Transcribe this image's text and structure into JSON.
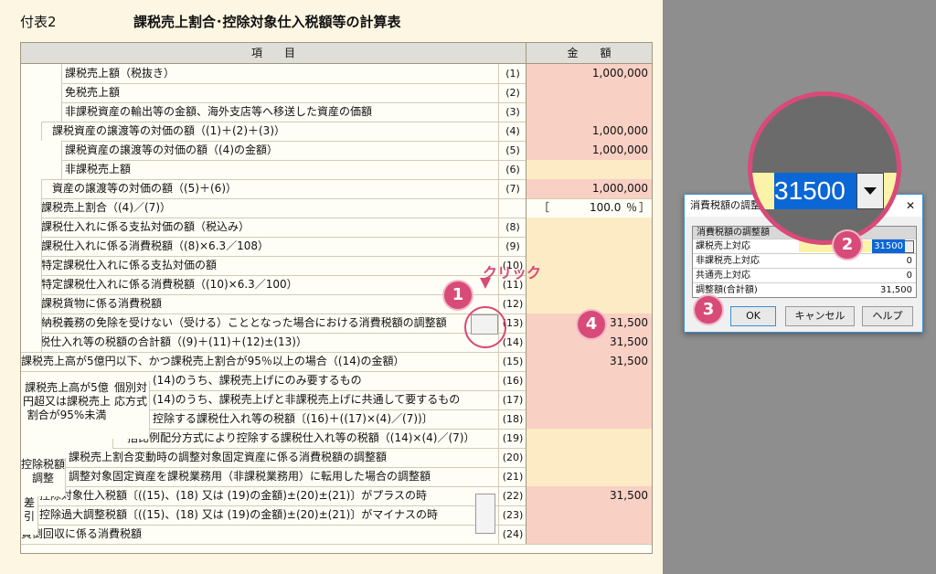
{
  "header": {
    "fuhyo": "付表2",
    "title": "課税売上割合･控除対象仕入税額等の計算表"
  },
  "table_header": {
    "item": "項　　目",
    "amount": "金　　額"
  },
  "rows": [
    {
      "label": "課税売上額（税抜き）",
      "num": "(1)",
      "amount": "1,000,000"
    },
    {
      "label": "免税売上額",
      "num": "(2)",
      "amount": ""
    },
    {
      "label": "非課税資産の輸出等の金額、海外支店等へ移送した資産の価額",
      "num": "(3)",
      "amount": ""
    },
    {
      "label": "課税資産の譲渡等の対価の額（(1)＋(2)＋(3)）",
      "num": "(4)",
      "amount": "1,000,000"
    },
    {
      "label": "課税資産の譲渡等の対価の額（(4)の金額）",
      "num": "(5)",
      "amount": "1,000,000"
    },
    {
      "label": "非課税売上額",
      "num": "(6)",
      "amount": ""
    },
    {
      "label": "資産の譲渡等の対価の額（(5)＋(6)）",
      "num": "(7)",
      "amount": "1,000,000"
    },
    {
      "label": "課税売上割合（(4)／(7)）",
      "num": "",
      "amount": ""
    },
    {
      "label": "課税仕入れに係る支払対価の額（税込み）",
      "num": "(8)",
      "amount": ""
    },
    {
      "label": "課税仕入れに係る消費税額（(8)×6.3／108）",
      "num": "(9)",
      "amount": ""
    },
    {
      "label": "特定課税仕入れに係る支払対価の額",
      "num": "(10)",
      "amount": ""
    },
    {
      "label": "特定課税仕入れに係る消費税額（(10)×6.3／100）",
      "num": "(11)",
      "amount": ""
    },
    {
      "label": "課税貨物に係る消費税額",
      "num": "(12)",
      "amount": ""
    },
    {
      "label": "納税義務の免除を受けない（受ける）こととなった場合における消費税額の調整額",
      "num": "(13)",
      "amount": "31,500"
    },
    {
      "label": "課税仕入れ等の税額の合計額（(9)＋(11)＋(12)±(13)）",
      "num": "(14)",
      "amount": "31,500"
    },
    {
      "label": "課税売上高が5億円以下、かつ課税売上割合が95％以上の場合（(14)の金額）",
      "num": "(15)",
      "amount": "31,500"
    },
    {
      "label": "(14)のうち、課税売上げにのみ要するもの",
      "num": "(16)",
      "amount": ""
    },
    {
      "label": "(14)のうち、課税売上げと非課税売上げに共通して要するもの",
      "num": "(17)",
      "amount": ""
    },
    {
      "label": "控除する課税仕入れ等の税額〔(16)＋((17)×(4)／(7))〕",
      "num": "(18)",
      "amount": ""
    },
    {
      "label": "一括比例配分方式により控除する課税仕入れ等の税額（(14)×(4)／(7)）",
      "num": "(19)",
      "amount": ""
    },
    {
      "label": "課税売上割合変動時の調整対象固定資産に係る消費税額の調整額",
      "num": "(20)",
      "amount": ""
    },
    {
      "label": "調整対象固定資産を課税業務用（非課税業務用）に転用した場合の調整額",
      "num": "(21)",
      "amount": ""
    },
    {
      "label": "控除対象仕入税額〔((15)、(18) 又は (19)の金額)±(20)±(21)〕がプラスの時",
      "num": "(22)",
      "amount": "31,500"
    },
    {
      "label": "控除過大調整税額〔((15)、(18) 又は (19)の金額)±(20)±(21)〕がマイナスの時",
      "num": "(23)",
      "amount": ""
    },
    {
      "label": "貸倒回収に係る消費税額",
      "num": "(24)",
      "amount": ""
    }
  ],
  "ratio": {
    "open": "［",
    "value": "100.0",
    "unit": "％",
    "close": "］"
  },
  "side_labels": {
    "kazei": "課税売上高が5億円超又は課税売上割合が95%未満",
    "kobetsu": "個別対応方式",
    "koujo": "控除税額調整",
    "sa": "差引"
  },
  "annotations": {
    "click": "クリック",
    "b1": "1",
    "b2": "2",
    "b3": "3",
    "b4": "4"
  },
  "magnifier": {
    "value": "31500"
  },
  "dialog": {
    "title": "消費税額の調整額",
    "group": "消費税額の調整額",
    "rows": [
      {
        "label": "課税売上対応",
        "value": "31500"
      },
      {
        "label": "非課税売上対応",
        "value": "0"
      },
      {
        "label": "共通売上対応",
        "value": "0"
      },
      {
        "label": "調整額(合計額)",
        "value": "31,500"
      }
    ],
    "ok": "OK",
    "cancel": "キャンセル",
    "help": "ヘルプ",
    "close": "✕"
  },
  "colors": {
    "accent": "#d84a78",
    "input_pink": "#f8d0c4",
    "input_yellow": "#fcebc5"
  }
}
